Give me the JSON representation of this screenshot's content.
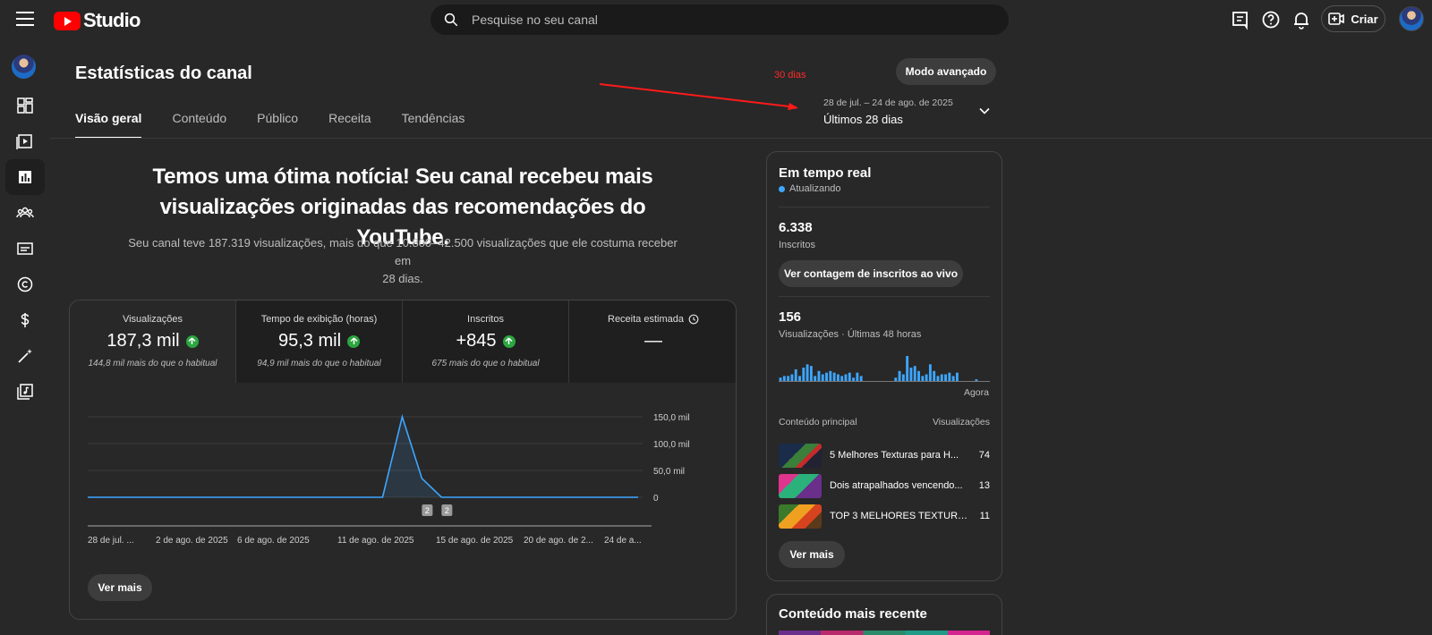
{
  "app": {
    "brand": "Studio",
    "brand_color": "#ff0000"
  },
  "search": {
    "placeholder": "Pesquise no seu canal"
  },
  "topbar": {
    "create_label": "Criar"
  },
  "page": {
    "title": "Estatísticas do canal",
    "tabs": [
      "Visão geral",
      "Conteúdo",
      "Público",
      "Receita",
      "Tendências"
    ],
    "active_tab": "Visão geral",
    "advanced_button": "Modo avançado",
    "date_range": {
      "range": "28 de jul. – 24 de ago. de 2025",
      "period": "Últimos 28 dias"
    },
    "annotation": {
      "text": "30 dias",
      "color": "#ff2a2a"
    }
  },
  "headline": {
    "title_line1": "Temos uma ótima notícia! Seu canal recebeu mais",
    "title_line2": "visualizações originadas das recomendações do YouTube.",
    "subtitle_line1": "Seu canal teve 187.319 visualizações, mais do que 10.800–42.500 visualizações que ele costuma receber em",
    "subtitle_line2": "28 dias."
  },
  "metrics": [
    {
      "label": "Visualizações",
      "value": "187,3 mil",
      "note": "144,8 mil mais do que o habitual",
      "trend": "up"
    },
    {
      "label": "Tempo de exibição (horas)",
      "value": "95,3 mil",
      "note": "94,9 mil mais do que o habitual",
      "trend": "up"
    },
    {
      "label": "Inscritos",
      "value": "+845",
      "note": "675 mais do que o habitual",
      "trend": "up"
    },
    {
      "label": "Receita estimada",
      "value": "—",
      "note": "",
      "trend": "none"
    }
  ],
  "chart_data": {
    "type": "area",
    "series": [
      {
        "values": [
          0,
          0,
          0,
          0,
          0,
          0,
          0,
          0,
          0,
          0,
          0,
          0,
          0,
          0,
          0,
          0,
          150000,
          35000,
          0,
          0,
          0,
          0,
          0,
          0,
          0,
          0,
          0,
          0,
          0
        ]
      }
    ],
    "x_tick_labels": [
      "28 de jul. ...",
      "2 de ago. de 2025",
      "6 de ago. de 2025",
      "11 de ago. de 2025",
      "15 de ago. de 2025",
      "20 de ago. de 2...",
      "24 de a..."
    ],
    "y_tick_labels": [
      "150,0 mil",
      "100,0 mil",
      "50,0 mil",
      "0"
    ],
    "ylim": [
      0,
      150000
    ],
    "markers": [
      "2",
      "2"
    ],
    "line_color": "#3ea6ff"
  },
  "overview": {
    "see_more": "Ver mais"
  },
  "realtime": {
    "title": "Em tempo real",
    "status": "Atualizando",
    "subscribers": {
      "value": "6.338",
      "label": "Inscritos",
      "button": "Ver contagem de inscritos ao vivo"
    },
    "views": {
      "value": "156",
      "label": "Visualizações · Últimas 48 horas",
      "now_label": "Agora"
    },
    "bar_values": [
      2,
      3,
      3,
      4,
      7,
      3,
      8,
      10,
      9,
      3,
      6,
      4,
      5,
      6,
      5,
      4,
      3,
      4,
      5,
      2,
      5,
      3,
      0,
      0,
      0,
      0,
      0,
      0,
      0,
      0,
      2,
      6,
      4,
      15,
      8,
      9,
      6,
      3,
      4,
      10,
      6,
      3,
      4,
      4,
      5,
      3,
      5,
      0,
      0,
      0,
      0,
      1,
      0,
      0,
      0
    ],
    "top_content": {
      "header_left": "Conteúdo principal",
      "header_right": "Visualizações",
      "items": [
        {
          "title": "5 Melhores Texturas para H...",
          "views": "74"
        },
        {
          "title": "Dois atrapalhados vencendo...",
          "views": "13"
        },
        {
          "title": "TOP 3 MELHORES TEXTURA...",
          "views": "11"
        }
      ]
    },
    "see_more": "Ver mais"
  },
  "recent": {
    "title": "Conteúdo mais recente"
  }
}
